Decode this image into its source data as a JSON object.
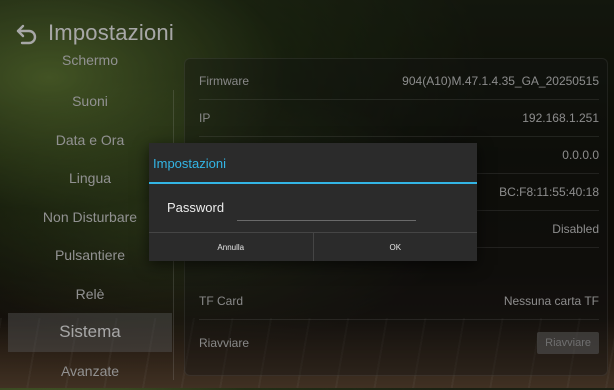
{
  "header": {
    "title": "Impostazioni",
    "back_icon": "back-arrow-icon"
  },
  "sidebar": {
    "items": [
      {
        "label": "Schermo"
      },
      {
        "label": "Suoni"
      },
      {
        "label": "Data e Ora"
      },
      {
        "label": "Lingua"
      },
      {
        "label": "Non Disturbare"
      },
      {
        "label": "Pulsantiere"
      },
      {
        "label": "Relè"
      },
      {
        "label": "Sistema",
        "active": true
      },
      {
        "label": "Avanzate"
      }
    ]
  },
  "panel": {
    "rows": [
      {
        "label": "Firmware",
        "value": "904(A10)M.47.1.4.35_GA_20250515"
      },
      {
        "label": "IP",
        "value": "192.168.1.251"
      },
      {
        "label": "",
        "value": "0.0.0.0"
      },
      {
        "label": "",
        "value": "BC:F8:11:55:40:18"
      },
      {
        "label": "",
        "value": "Disabled"
      },
      {
        "label": "TF Card",
        "value": "Nessuna carta TF"
      },
      {
        "label": "Riavviare",
        "button": "Riavviare"
      }
    ]
  },
  "dialog": {
    "title": "Impostazioni",
    "field_label": "Password",
    "field_value": "",
    "cancel": "Annulla",
    "ok": "OK"
  },
  "colors": {
    "accent": "#33b5e5",
    "dialog_bg": "#2b2b2b"
  }
}
